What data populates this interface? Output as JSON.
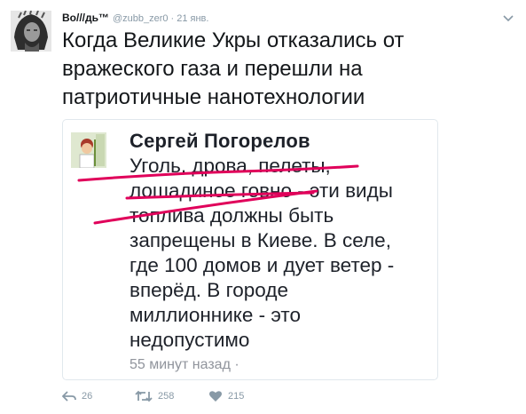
{
  "tweet": {
    "author_name": "Во///дь™",
    "handle": "@zubb_zer0",
    "separator": "·",
    "date": "21 янв.",
    "text_lines": [
      "Когда Великие Укры отказались от",
      "вражеского газа и перешли на",
      "патриотичные нанотехнологии"
    ]
  },
  "quoted_post": {
    "author_name": "Сергей Погорелов",
    "text_lines": [
      "Уголь, дрова, пелеты,",
      "лошадиное говно - эти виды",
      "топлива должны быть",
      "запрещены в Киеве. В селе,",
      "где 100 домов и дует ветер -",
      "вперёд. В городе",
      "миллионнике - это",
      "недопустимо"
    ],
    "time": "55 минут назад ·",
    "underline_color": "#e0005a"
  },
  "actions": {
    "reply_count": "26",
    "retweet_count": "258",
    "like_count": "215"
  },
  "colors": {
    "text": "#14171a",
    "muted": "#8899a6",
    "card_border": "#e1e8ed"
  }
}
